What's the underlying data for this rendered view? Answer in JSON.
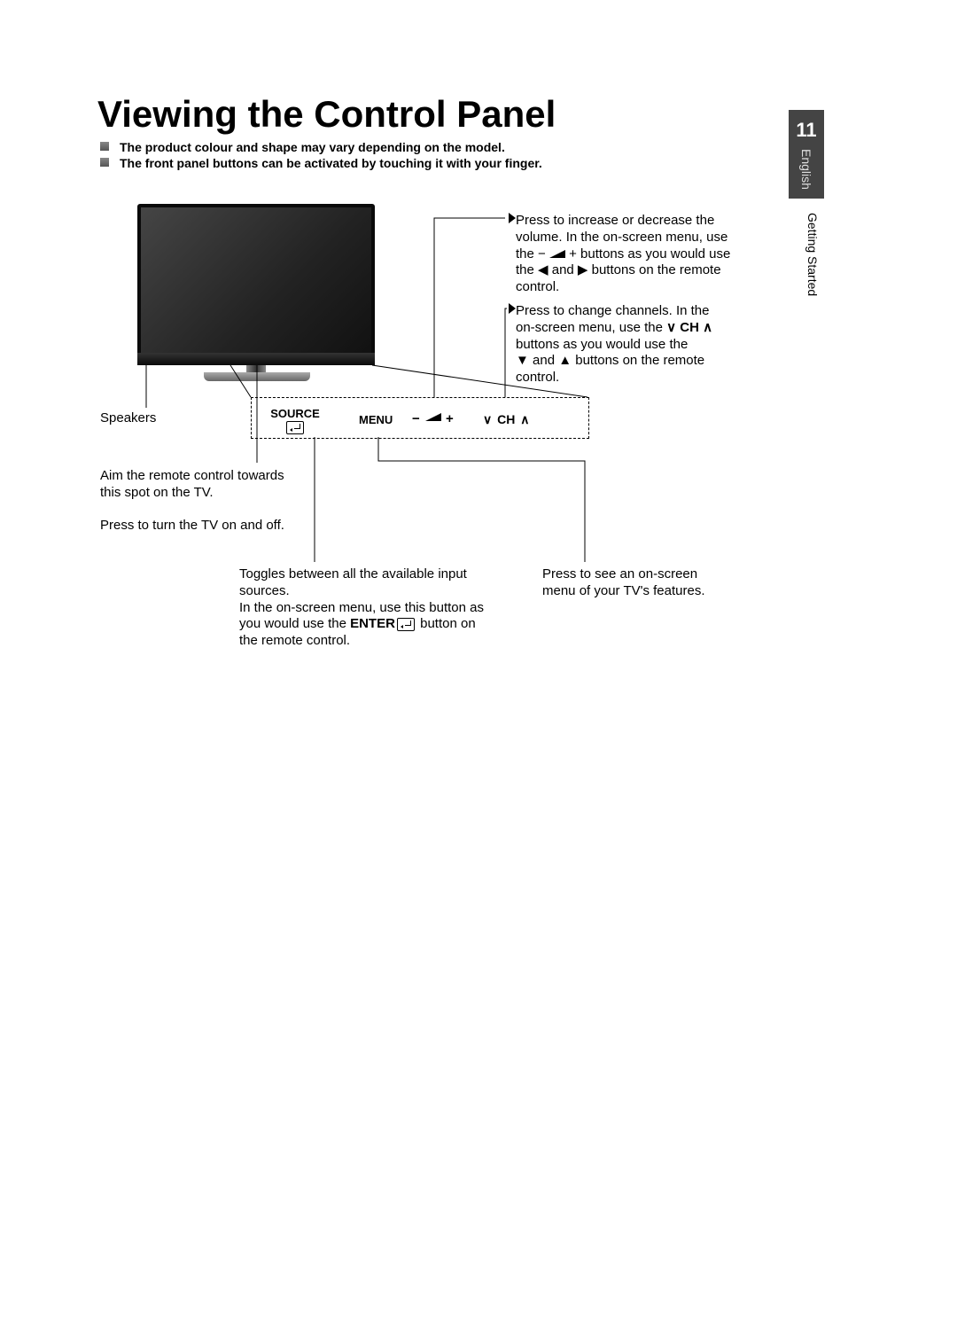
{
  "page_number": "11",
  "language": "English",
  "section": "Getting Started",
  "title": "Viewing the Control Panel",
  "notes": [
    "The product colour and shape may vary depending on the model.",
    "The front panel buttons can be activated by touching it with your finger."
  ],
  "panel_labels": {
    "source": "SOURCE",
    "menu": "MENU",
    "vol_minus": "−",
    "vol_plus": "+",
    "ch_down": "∨",
    "ch": "CH",
    "ch_up": "∧"
  },
  "callouts": {
    "volume": {
      "l1": "Press to increase or decrease the",
      "l2": "volume. In the on-screen menu, use",
      "l3": "the − ",
      "l3b": " + buttons as you would use",
      "l4": "the ◀ and ▶ buttons on the remote",
      "l5": "control."
    },
    "channel": {
      "l1": "Press to change channels. In the",
      "l2a": "on-screen menu, use the ",
      "l2b": "∨ CH ∧",
      "l3": "buttons as you would use the",
      "l4": "▼ and ▲ buttons on the remote",
      "l5": "control."
    },
    "speakers": "Speakers",
    "remote_power": {
      "l1": "Aim the remote control towards",
      "l2": "this spot on the TV.",
      "l3": "Press to turn the TV on and off."
    },
    "source": {
      "l1": "Toggles between all the available input",
      "l2": "sources.",
      "l3": "In the on-screen menu, use this button as",
      "l4a": "you would use the ",
      "l4b": "ENTER",
      "l4c": " button on",
      "l5": "the remote control."
    },
    "menu": {
      "l1": "Press to see an on-screen",
      "l2": "menu of your TV's features."
    }
  }
}
